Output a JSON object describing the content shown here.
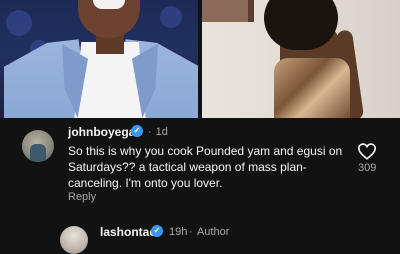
{
  "post": {
    "images": [
      {
        "name": "photo-man-blue-suit"
      },
      {
        "name": "photo-woman-metallic-dress"
      }
    ]
  },
  "comment": {
    "username": "johnboyega",
    "verified_glyph": "✓",
    "time": "1d",
    "text": "So this is why you cook Pounded yam and egusi on Saturdays?? a tactical weapon of mass plan-canceling. I'm onto you lover.",
    "reply_label": "Reply",
    "like_count": "309",
    "icons": {
      "avatar": "avatar-icon",
      "like": "heart-icon",
      "verified": "verified-badge-icon"
    }
  },
  "reply": {
    "username": "lashontae",
    "verified_glyph": "✓",
    "time": "19h",
    "separator": "·",
    "author_tag": "Author"
  },
  "colors": {
    "background": "#121212",
    "primary_text": "#f5f5f5",
    "secondary_text": "#a8a8a8",
    "verified_blue": "#3897f0"
  }
}
